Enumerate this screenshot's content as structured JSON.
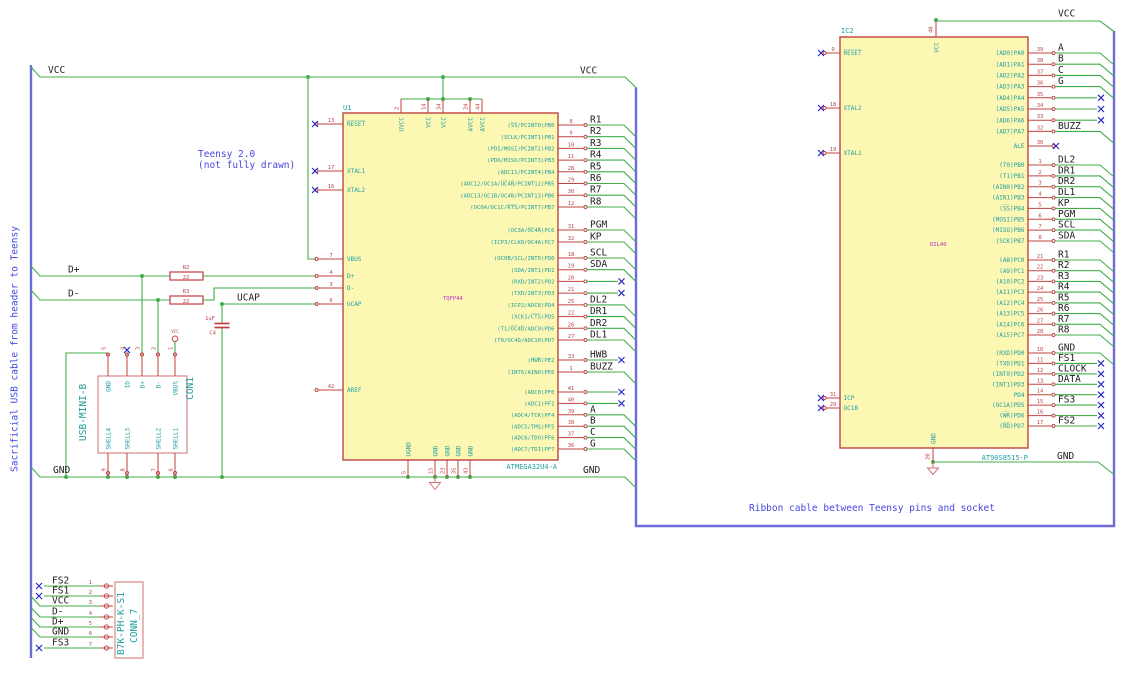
{
  "notes": {
    "teensy_line1": "Teensy 2.0",
    "teensy_line2": "(not fully drawn)",
    "ribbon": "Ribbon cable between Teensy pins and socket",
    "usb_cable": "Sacrificial USB cable from header to Teensy"
  },
  "labels": {
    "vcc_left": "VCC",
    "vcc_right": "VCC",
    "vcc_ic2": "VCC",
    "gnd_left": "GND",
    "gnd_right": "GND",
    "gnd_ic2": "GND",
    "dplus": "D+",
    "dminus": "D-",
    "ucap": "UCAP"
  },
  "colors": {
    "wire_green": "#3fae49",
    "bus_violet": "#6b6bdc",
    "symbol_red": "#c04343",
    "body_yellow": "#fcf8b4",
    "pin_name_teal": "#1f9ea0",
    "note_blue": "#4646e2",
    "net_label_black": "#1c1c1c",
    "footprint_magenta": "#bb2dbb"
  },
  "u1": {
    "ref": "U1",
    "value": "ATMEGA32U4-A",
    "footprint": "TQFP44",
    "pins_right": [
      {
        "num": "8",
        "name": "(S̅S̅/PCINT0)PB0",
        "label": "R1",
        "term": "bus"
      },
      {
        "num": "9",
        "name": "(SCLK/PCINT1)PB1",
        "label": "R2",
        "term": "bus"
      },
      {
        "num": "10",
        "name": "(PDI/MOSI/PCINT2)PB2",
        "label": "R3",
        "term": "bus"
      },
      {
        "num": "11",
        "name": "(PDO/MISO/PCINT3)PB3",
        "label": "R4",
        "term": "bus"
      },
      {
        "num": "28",
        "name": "(ADC11/PCINT4)PB4",
        "label": "R5",
        "term": "bus"
      },
      {
        "num": "29",
        "name": "(ADC12/OC1A/O̅C̅4̅B̅/PCINT12)PB5",
        "label": "R6",
        "term": "bus"
      },
      {
        "num": "30",
        "name": "(ADC13/OC1B/OC4B/PCINT13)PB6",
        "label": "R7",
        "term": "bus"
      },
      {
        "num": "12",
        "name": "(OC0A/OC1C/R̅T̅S̅/PCINT7)PB7",
        "label": "R8",
        "term": "bus"
      },
      {
        "num": "31",
        "name": "(OC3A/O̅C̅4̅A̅)PC6",
        "label": "PGM",
        "term": "bus"
      },
      {
        "num": "32",
        "name": "(ICP3/CLK0/OC4A)PC7",
        "label": "KP",
        "term": "bus"
      },
      {
        "num": "18",
        "name": "(OC0B/SCL/INT0)PD0",
        "label": "SCL",
        "term": "bus"
      },
      {
        "num": "19",
        "name": "(SDA/INT1)PD1",
        "label": "SDA",
        "term": "bus"
      },
      {
        "num": "20",
        "name": "(RXD/INT2)PD2",
        "label": "",
        "term": "nc"
      },
      {
        "num": "21",
        "name": "(TXD/INT3)PD3",
        "label": "",
        "term": "nc"
      },
      {
        "num": "25",
        "name": "(ICP2/ADC8)PD4",
        "label": "DL2",
        "term": "bus"
      },
      {
        "num": "22",
        "name": "(XCK1/C̅T̅S̅)PD5",
        "label": "DR1",
        "term": "bus"
      },
      {
        "num": "26",
        "name": "(T1/O̅C̅4̅D̅/ADC9)PD6",
        "label": "DR2",
        "term": "bus"
      },
      {
        "num": "27",
        "name": "(T0/OC4D/ADC10)PD7",
        "label": "DL1",
        "term": "bus"
      },
      {
        "num": "33",
        "name": "(H̅W̅B̅)PE2",
        "label": "HWB",
        "term": "nclabel"
      },
      {
        "num": "1",
        "name": "(INT6/AIN0)PE6",
        "label": "BUZZ",
        "term": "bus"
      },
      {
        "num": "41",
        "name": "(ADC0)PF0",
        "label": "",
        "term": "nc"
      },
      {
        "num": "40",
        "name": "(ADC1)PF1",
        "label": "",
        "term": "nc"
      },
      {
        "num": "39",
        "name": "(ADC4/TCK)PF4",
        "label": "A",
        "term": "bus"
      },
      {
        "num": "38",
        "name": "(ADC5/TMS)PF5",
        "label": "B",
        "term": "bus"
      },
      {
        "num": "37",
        "name": "(ADC6/TDO)PF6",
        "label": "C",
        "term": "bus"
      },
      {
        "num": "36",
        "name": "(ADC7/TDI)PF7",
        "label": "G",
        "term": "bus"
      }
    ],
    "pins_left": [
      {
        "num": "13",
        "name": "R̅E̅S̅E̅T̅",
        "term": "nc"
      },
      {
        "num": "17",
        "name": "XTAL1",
        "term": "nc"
      },
      {
        "num": "16",
        "name": "XTAL2",
        "term": "nc"
      },
      {
        "num": "7",
        "name": "VBUS",
        "term": "wire"
      },
      {
        "num": "4",
        "name": "D+",
        "term": "wire"
      },
      {
        "num": "3",
        "name": "D-",
        "term": "wire"
      },
      {
        "num": "6",
        "name": "UCAP",
        "term": "wire"
      },
      {
        "num": "42",
        "name": "AREF",
        "term": "open"
      }
    ],
    "pins_top": [
      {
        "num": "2",
        "name": "UVCC"
      },
      {
        "num": "14",
        "name": "VCC"
      },
      {
        "num": "34",
        "name": "VCC"
      },
      {
        "num": "24",
        "name": "AVCC"
      },
      {
        "num": "44",
        "name": "AVCC"
      }
    ],
    "pins_bottom": [
      {
        "num": "5",
        "name": "UGND"
      },
      {
        "num": "15",
        "name": "GND"
      },
      {
        "num": "23",
        "name": "GND"
      },
      {
        "num": "35",
        "name": "GND"
      },
      {
        "num": "43",
        "name": "GND"
      }
    ]
  },
  "ic2": {
    "ref": "IC2",
    "value": "AT90S8515-P",
    "footprint": "DIL40",
    "top_pin": {
      "num": "40",
      "name": "VCC"
    },
    "bottom_pin": {
      "num": "20",
      "name": "GND"
    },
    "pins_right": [
      {
        "num": "39",
        "name": "(AD0)PA0",
        "label": "A",
        "term": "bus"
      },
      {
        "num": "38",
        "name": "(AD1)PA1",
        "label": "B",
        "term": "bus"
      },
      {
        "num": "37",
        "name": "(AD2)PA2",
        "label": "C",
        "term": "bus"
      },
      {
        "num": "36",
        "name": "(AD3)PA3",
        "label": "G",
        "term": "bus"
      },
      {
        "num": "35",
        "name": "(AD4)PA4",
        "label": "",
        "term": "nc"
      },
      {
        "num": "34",
        "name": "(AD5)PA5",
        "label": "",
        "term": "nc"
      },
      {
        "num": "33",
        "name": "(AD6)PA6",
        "label": "",
        "term": "nc"
      },
      {
        "num": "32",
        "name": "(AD7)PA7",
        "label": "BUZZ",
        "term": "bus"
      },
      {
        "num": "30",
        "name": "ALE",
        "label": "",
        "term": "ncpin"
      },
      {
        "num": "1",
        "name": "(T0)PB0",
        "label": "DL2",
        "term": "bus"
      },
      {
        "num": "2",
        "name": "(T1)PB1",
        "label": "DR1",
        "term": "bus"
      },
      {
        "num": "3",
        "name": "(AIN0)PB2",
        "label": "DR2",
        "term": "bus"
      },
      {
        "num": "4",
        "name": "(AIN1)PB3",
        "label": "DL1",
        "term": "bus"
      },
      {
        "num": "5",
        "name": "(S̅S̅)PB4",
        "label": "KP",
        "term": "bus"
      },
      {
        "num": "6",
        "name": "(MOSI)PB5",
        "label": "PGM",
        "term": "bus"
      },
      {
        "num": "7",
        "name": "(MISO)PB6",
        "label": "SCL",
        "term": "bus"
      },
      {
        "num": "8",
        "name": "(SCK)PB7",
        "label": "SDA",
        "term": "bus"
      },
      {
        "num": "21",
        "name": "(A8)PC0",
        "label": "R1",
        "term": "bus"
      },
      {
        "num": "22",
        "name": "(A9)PC1",
        "label": "R2",
        "term": "bus"
      },
      {
        "num": "23",
        "name": "(A10)PC2",
        "label": "R3",
        "term": "bus"
      },
      {
        "num": "24",
        "name": "(A11)PC3",
        "label": "R4",
        "term": "bus"
      },
      {
        "num": "25",
        "name": "(A12)PC4",
        "label": "R5",
        "term": "bus"
      },
      {
        "num": "26",
        "name": "(A13)PC5",
        "label": "R6",
        "term": "bus"
      },
      {
        "num": "27",
        "name": "(A14)PC6",
        "label": "R7",
        "term": "bus"
      },
      {
        "num": "28",
        "name": "(A15)PC7",
        "label": "R8",
        "term": "bus"
      },
      {
        "num": "10",
        "name": "(RXD)PD0",
        "label": "GND",
        "term": "bus"
      },
      {
        "num": "11",
        "name": "(TXD)PD1",
        "label": "FS1",
        "term": "nclabel"
      },
      {
        "num": "12",
        "name": "(INT0)PD2",
        "label": "CLOCK",
        "term": "nclabel"
      },
      {
        "num": "13",
        "name": "(INT1)PD3",
        "label": "DATA",
        "term": "nclabel"
      },
      {
        "num": "14",
        "name": "PD4",
        "label": "",
        "term": "nc"
      },
      {
        "num": "15",
        "name": "(OC1A)PD5",
        "label": "FS3",
        "term": "nclabel"
      },
      {
        "num": "16",
        "name": "(W̅R̅)PD6",
        "label": "",
        "term": "nc"
      },
      {
        "num": "17",
        "name": "(R̅D̅)PD7",
        "label": "FS2",
        "term": "nclabel"
      }
    ],
    "pins_left": [
      {
        "num": "9",
        "name": "R̅E̅S̅E̅T̅",
        "term": "nc"
      },
      {
        "num": "18",
        "name": "XTAL2",
        "term": "nc"
      },
      {
        "num": "19",
        "name": "XTAL1",
        "term": "nc"
      },
      {
        "num": "31",
        "name": "ICP",
        "term": "nc"
      },
      {
        "num": "29",
        "name": "OC1B",
        "term": "nc"
      }
    ]
  },
  "con1": {
    "ref": "CON1",
    "value": "USB-MINI-B",
    "vcc_symbol": "VCC",
    "pins_top": [
      {
        "num": "5",
        "name": "GND"
      },
      {
        "num": "4",
        "name": "ID"
      },
      {
        "num": "3",
        "name": "D+"
      },
      {
        "num": "2",
        "name": "D-"
      },
      {
        "num": "1",
        "name": "VBUS"
      }
    ],
    "pins_bottom": [
      {
        "num": "9",
        "name": "SHELL4"
      },
      {
        "num": "8",
        "name": "SHELL3"
      },
      {
        "num": "7",
        "name": "SHELL2"
      },
      {
        "num": "6",
        "name": "SHELL1"
      }
    ]
  },
  "conn7": {
    "ref": "CONN_7",
    "value": "B7K-PH-K-S1",
    "rows": [
      {
        "num": "1",
        "label": "FS2",
        "term": "nc"
      },
      {
        "num": "2",
        "label": "FS1",
        "term": "nc"
      },
      {
        "num": "3",
        "label": "VCC",
        "term": "bus"
      },
      {
        "num": "4",
        "label": "D-",
        "term": "bus"
      },
      {
        "num": "5",
        "label": "D+",
        "term": "bus"
      },
      {
        "num": "6",
        "label": "GND",
        "term": "bus"
      },
      {
        "num": "7",
        "label": "FS3",
        "term": "nc"
      }
    ]
  },
  "r2": {
    "ref": "R2",
    "value": "22"
  },
  "r3": {
    "ref": "R3",
    "value": "22"
  },
  "c4": {
    "ref": "C4",
    "value": "1uF"
  }
}
